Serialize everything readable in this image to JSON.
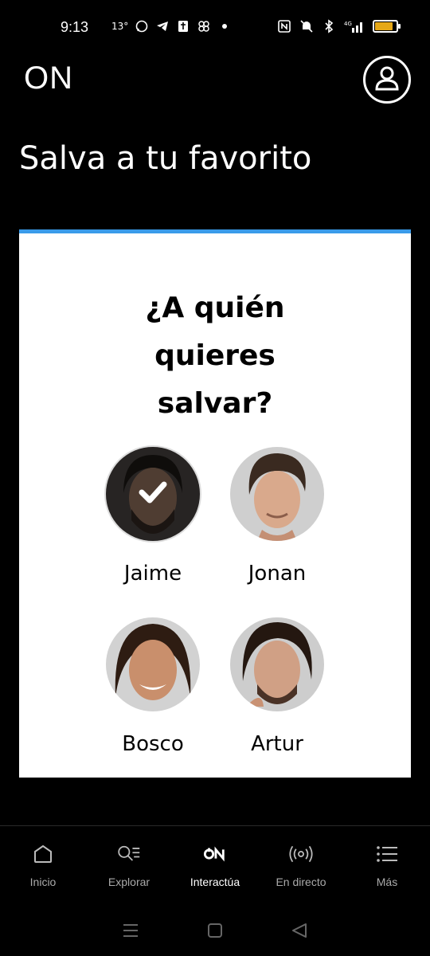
{
  "status_bar": {
    "time": "9:13",
    "temperature": "13°",
    "network": "4G",
    "battery_level": 0.85,
    "battery_color": "#e6a817"
  },
  "header": {
    "logo": "ON",
    "profile_icon": "user-icon"
  },
  "page": {
    "title": "Salva a tu favorito"
  },
  "card": {
    "accent_color": "#3a9be9",
    "question": "¿A quién quieres salvar?",
    "candidates": [
      {
        "name": "Jaime",
        "selected": true
      },
      {
        "name": "Jonan",
        "selected": false
      },
      {
        "name": "Bosco",
        "selected": false
      },
      {
        "name": "Artur",
        "selected": false
      }
    ]
  },
  "bottom_nav": {
    "items": [
      {
        "label": "Inicio",
        "icon": "home-icon"
      },
      {
        "label": "Explorar",
        "icon": "search-list-icon"
      },
      {
        "label": "Interactúa",
        "icon": "on-logo-icon",
        "active": true
      },
      {
        "label": "En directo",
        "icon": "broadcast-icon"
      },
      {
        "label": "Más",
        "icon": "menu-icon"
      }
    ]
  },
  "system_nav": {
    "items": [
      "recents-icon",
      "home-icon",
      "back-icon"
    ]
  }
}
